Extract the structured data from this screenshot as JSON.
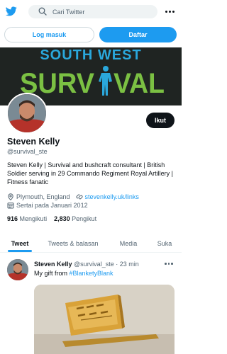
{
  "header": {
    "logo_icon": "twitter-bird-icon",
    "search_placeholder": "Cari Twitter",
    "more_icon": "more-horizontal-icon"
  },
  "auth": {
    "login_label": "Log masuk",
    "signup_label": "Daftar"
  },
  "banner": {
    "line1": "SOUTH WEST",
    "line2a": "SURV",
    "line2b": "VAL"
  },
  "profile": {
    "follow_label": "Ikut",
    "name": "Steven Kelly",
    "handle": "@survival_ste",
    "bio": "Steven Kelly | Survival and bushcraft consultant | British Soldier serving in 29 Commando Regiment Royal Artillery | Fitness fanatic",
    "location": "Plymouth, England",
    "website": "stevenkelly.uk/links",
    "joined": "Sertai pada Januari 2012",
    "following_count": "916",
    "following_label": "Mengikuti",
    "followers_count": "2,830",
    "followers_label": "Pengikut"
  },
  "tabs": [
    "Tweet",
    "Tweets & balasan",
    "Media",
    "Suka"
  ],
  "tweet": {
    "author": "Steven Kelly",
    "handle": "@survival_ste",
    "separator": "·",
    "time": "23 min",
    "text": "My gift from ",
    "hashtag": "#BlanketyBlank"
  },
  "colors": {
    "accent": "#1d9bf0",
    "banner_green": "#7bc043",
    "banner_blue": "#2aa8dc"
  }
}
